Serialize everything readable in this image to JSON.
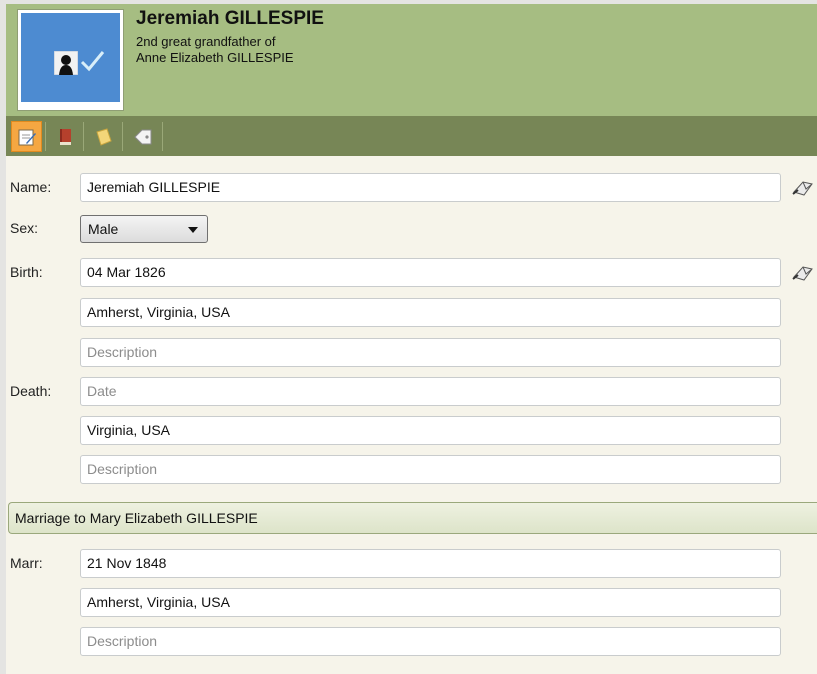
{
  "header": {
    "name": "Jeremiah GILLESPIE",
    "relation_line1": "2nd great grandfather of",
    "relation_line2": "Anne Elizabeth GILLESPIE"
  },
  "toolbar": {
    "buttons": [
      {
        "icon": "edit-icon",
        "active": true
      },
      {
        "icon": "book-icon",
        "active": false
      },
      {
        "icon": "note-icon",
        "active": false
      },
      {
        "icon": "tag-icon",
        "active": false
      }
    ]
  },
  "form": {
    "name_label": "Name:",
    "name_value": "Jeremiah GILLESPIE",
    "sex_label": "Sex:",
    "sex_value": "Male",
    "birth_label": "Birth:",
    "birth_date": "04 Mar 1826",
    "birth_place": "Amherst, Virginia, USA",
    "birth_description_placeholder": "Description",
    "death_label": "Death:",
    "death_date_placeholder": "Date",
    "death_place": "Virginia, USA",
    "death_description_placeholder": "Description"
  },
  "marriage": {
    "header": "Marriage to Mary Elizabeth GILLESPIE",
    "label": "Marr:",
    "date": "21 Nov 1848",
    "place": "Amherst, Virginia, USA",
    "description_placeholder": "Description"
  },
  "colors": {
    "header_bg": "#a6bd82",
    "toolbar_bg": "#778656",
    "active_tab": "#f5a742",
    "photo_bg": "#4d8bd1",
    "page_bg": "#f6f4ea"
  }
}
